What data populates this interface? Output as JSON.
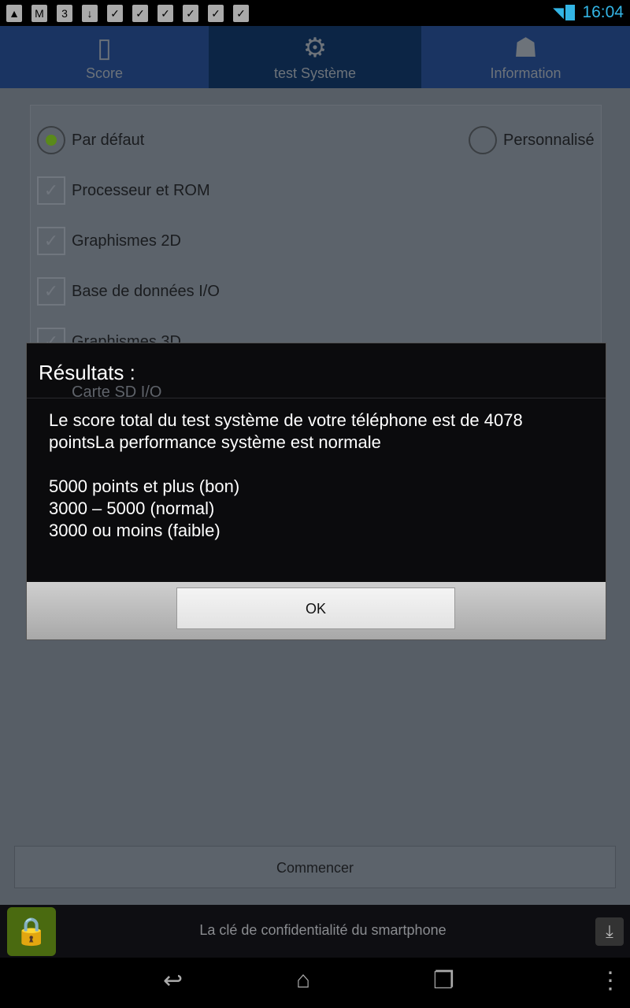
{
  "status": {
    "time": "16:04",
    "notification_icons": [
      "image-icon",
      "gmail-icon",
      "store-icon",
      "download-icon",
      "check-bag-icon",
      "check-bag-icon",
      "check-bag-icon",
      "check-bag-icon",
      "check-bag-icon",
      "check-bag-icon"
    ]
  },
  "tabs": [
    {
      "label": "Score",
      "icon": "phone-icon"
    },
    {
      "label": "test Système",
      "icon": "gear-icon",
      "selected": true
    },
    {
      "label": "Information",
      "icon": "android-icon"
    }
  ],
  "options": {
    "default_label": "Par défaut",
    "custom_label": "Personnalisé",
    "selected": "default",
    "items": [
      {
        "label": "Processeur et ROM",
        "checked": true
      },
      {
        "label": "Graphismes 2D",
        "checked": true
      },
      {
        "label": "Base de données I/O",
        "checked": true
      },
      {
        "label": "Graphismes 3D",
        "checked": true
      },
      {
        "label": "Carte SD I/O",
        "checked": true
      }
    ]
  },
  "dialog": {
    "title": "Résultats :",
    "message": "Le score total du test système de votre téléphone est de 4078 pointsLa performance système est normale\n\n5000 points et plus (bon)\n3000 – 5000 (normal)\n3000 ou moins (faible)",
    "ok_label": "OK"
  },
  "start_label": "Commencer",
  "ad": {
    "text": "La clé de confidentialité du smartphone"
  }
}
